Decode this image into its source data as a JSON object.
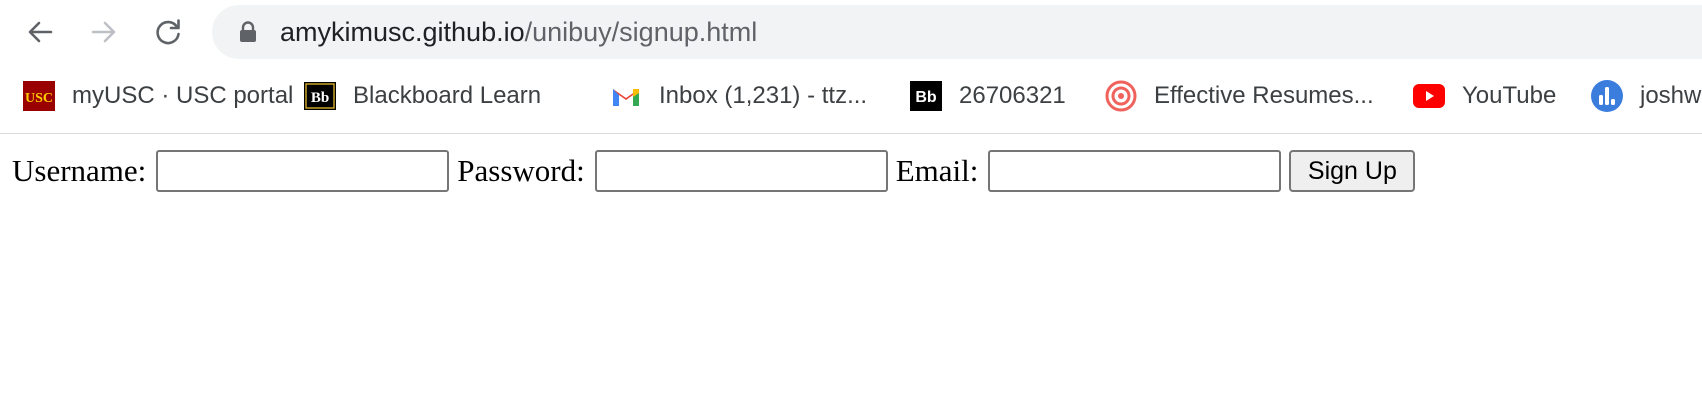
{
  "browser": {
    "url_domain": "amykimusc.github.io",
    "url_path": "/unibuy/signup.html"
  },
  "bookmarks": [
    {
      "label": "myUSC · USC portal",
      "icon": "usc-icon",
      "icon_text": "USC"
    },
    {
      "label": "Blackboard Learn",
      "icon": "blackboard-icon",
      "icon_text": "Bb"
    },
    {
      "label": "Inbox (1,231) - ttz...",
      "icon": "gmail-icon"
    },
    {
      "label": "26706321",
      "icon": "blackboard-icon",
      "icon_text": "Bb"
    },
    {
      "label": "Effective Resumes...",
      "icon": "target-icon"
    },
    {
      "label": "YouTube",
      "icon": "youtube-icon"
    },
    {
      "label": "joshw",
      "icon": "bar-chart-icon"
    }
  ],
  "form": {
    "username_label": "Username:",
    "username_value": "",
    "password_label": "Password:",
    "password_value": "",
    "email_label": "Email:",
    "email_value": "",
    "submit_label": "Sign Up"
  },
  "colors": {
    "omnibox_bg": "#f1f3f4",
    "usc_cardinal": "#990000",
    "usc_gold": "#ffcc00",
    "gmail_red": "#ea4335",
    "youtube_red": "#ff0000",
    "target_coral": "#f0635c",
    "chart_blue": "#3b7ddd"
  }
}
